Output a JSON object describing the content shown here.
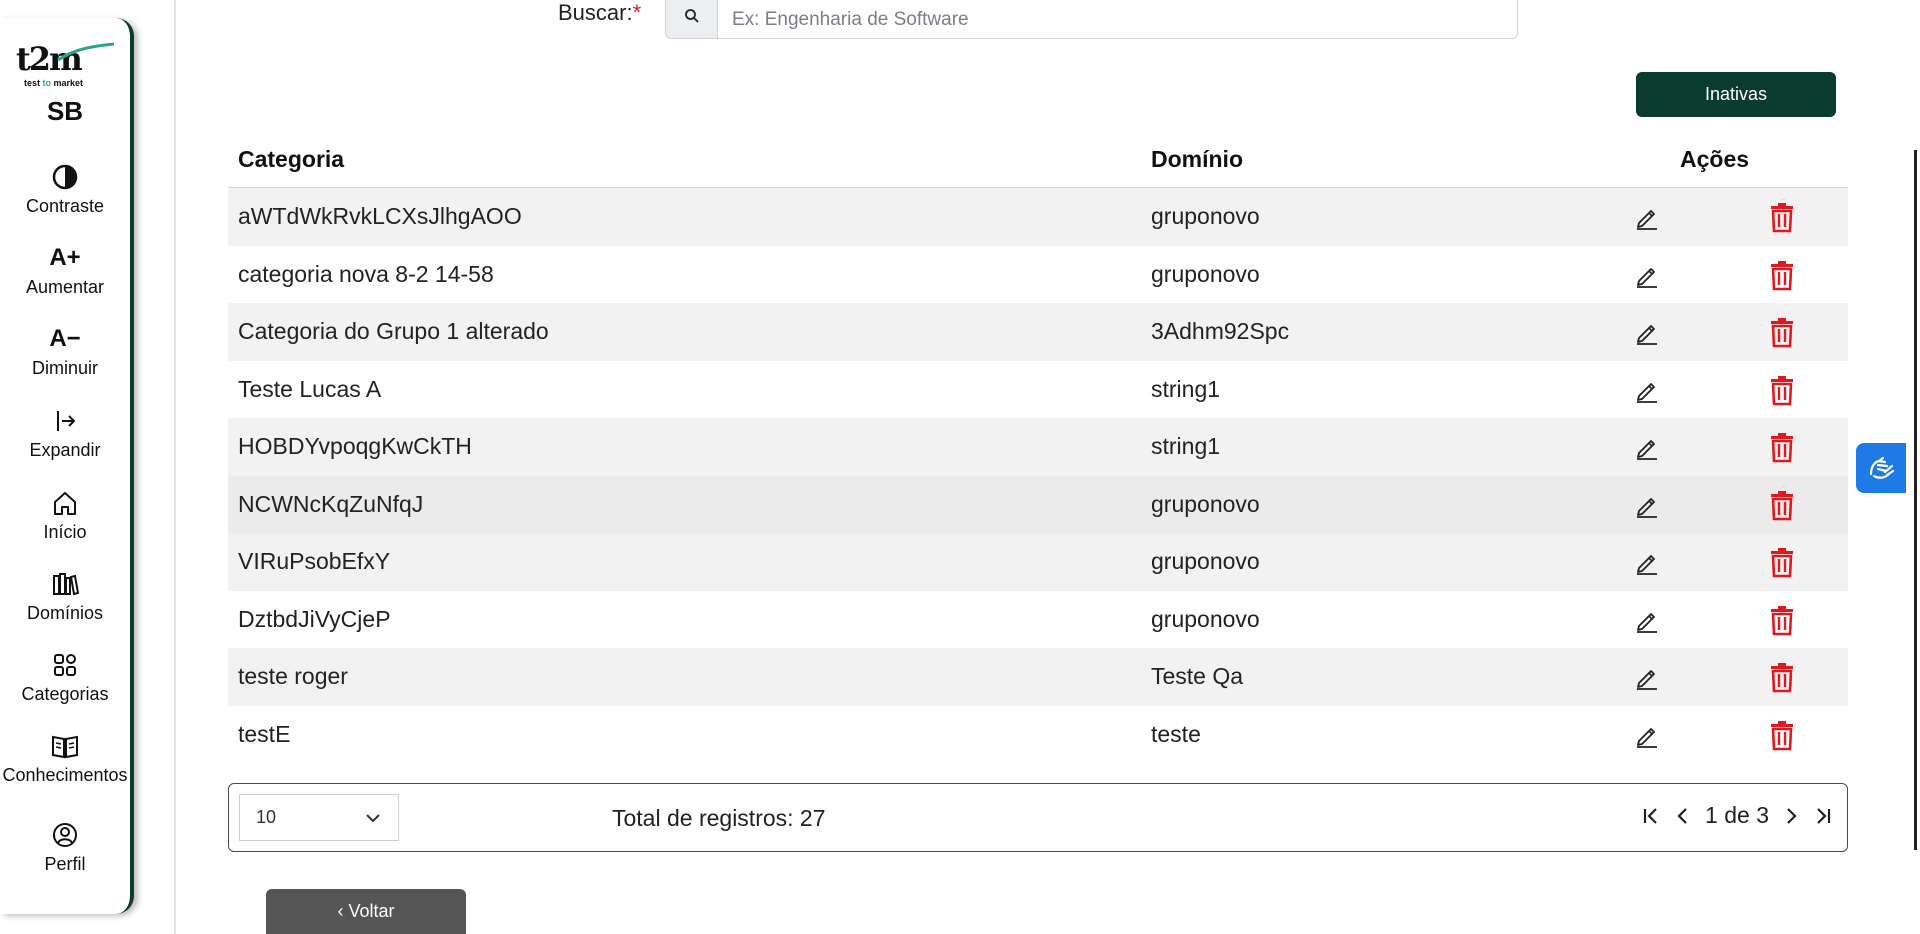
{
  "sidebar": {
    "brand_text": "t2m",
    "brand_sub_a": "test ",
    "brand_sub_b": "to",
    "brand_sub_c": " market",
    "short": "SB",
    "items": [
      {
        "label": "Contraste",
        "icon": "contrast-icon"
      },
      {
        "label": "Aumentar",
        "glyph": "A+",
        "icon": "font-increase-icon"
      },
      {
        "label": "Diminuir",
        "glyph": "A−",
        "icon": "font-decrease-icon"
      },
      {
        "label": "Expandir",
        "icon": "expand-icon"
      },
      {
        "label": "Início",
        "icon": "home-icon"
      },
      {
        "label": "Domínios",
        "icon": "books-icon"
      },
      {
        "label": "Categorias",
        "icon": "grid-icon"
      },
      {
        "label": "Conhecimentos",
        "icon": "open-book-icon"
      },
      {
        "label": "Perfil",
        "icon": "user-circle-icon"
      }
    ]
  },
  "search": {
    "label": "Buscar:",
    "required_mark": "*",
    "placeholder": "Ex: Engenharia de Software",
    "value": ""
  },
  "buttons": {
    "inativas": "Inativas",
    "voltar": "‹ Voltar"
  },
  "table": {
    "headers": {
      "category": "Categoria",
      "domain": "Domínio",
      "actions": "Ações"
    },
    "rows": [
      {
        "category": "aWTdWkRvkLCXsJlhgAOO",
        "domain": "gruponovo"
      },
      {
        "category": "categoria nova 8-2 14-58",
        "domain": "gruponovo"
      },
      {
        "category": "Categoria do Grupo 1 alterado",
        "domain": "3Adhm92Spc"
      },
      {
        "category": "Teste Lucas A",
        "domain": "string1"
      },
      {
        "category": "HOBDYvpoqgKwCkTH",
        "domain": "string1"
      },
      {
        "category": "NCWNcKqZuNfqJ",
        "domain": "gruponovo"
      },
      {
        "category": "VIRuPsobEfxY",
        "domain": "gruponovo"
      },
      {
        "category": "DztbdJiVyCjeP",
        "domain": "gruponovo"
      },
      {
        "category": "teste roger",
        "domain": "Teste Qa"
      },
      {
        "category": "testE",
        "domain": "teste"
      }
    ]
  },
  "pagination": {
    "page_size": "10",
    "total": "Total de registros: 27",
    "page_text": "1 de 3"
  },
  "colors": {
    "brand_dark": "#0b3b2e",
    "delete_red": "#e0191e",
    "a11y_blue": "#1e7ae6",
    "back_gray": "#555555"
  }
}
